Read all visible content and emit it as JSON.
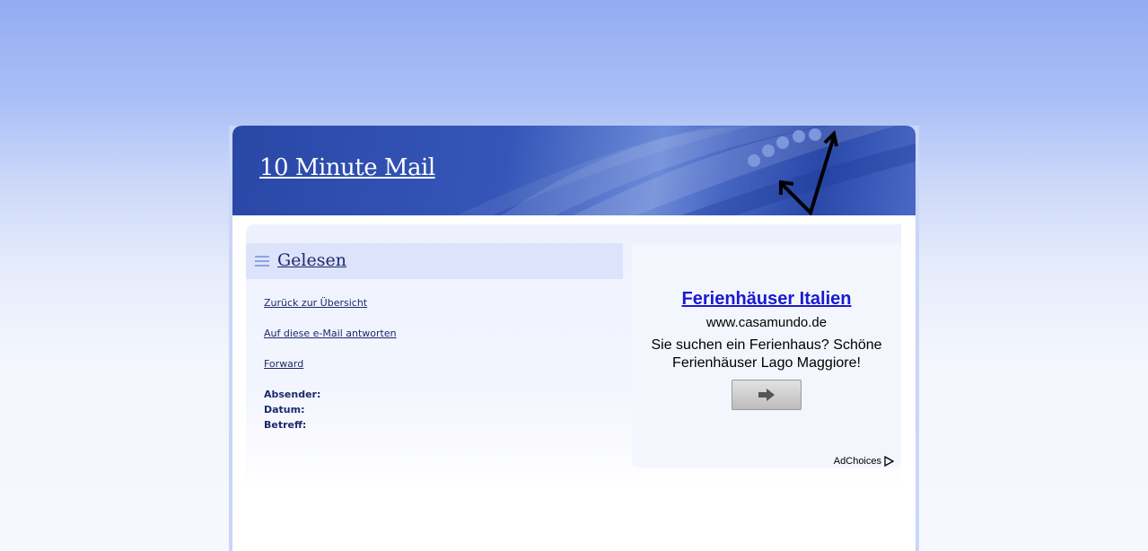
{
  "header": {
    "site_title": "10 Minute Mail"
  },
  "section": {
    "title": "Gelesen"
  },
  "nav": {
    "back_label": "Zurück zur Übersicht",
    "reply_label": "Auf diese e-Mail antworten",
    "forward_label": "Forward"
  },
  "meta": {
    "sender_label": "Absender:",
    "date_label": "Datum:",
    "subject_label": "Betreff:"
  },
  "ad": {
    "title": "Ferienhäuser Italien",
    "url": "www.casamundo.de",
    "description": "Sie suchen ein Ferienhaus? Schöne Ferienhäuser Lago Maggiore!",
    "adchoices_label": "AdChoices",
    "button_icon": "arrow-right-icon"
  },
  "colors": {
    "header_blue": "#2a47a6",
    "link_dark": "#1c2a6b",
    "ad_link": "#1a1ad0",
    "section_band": "#dde3fb"
  }
}
